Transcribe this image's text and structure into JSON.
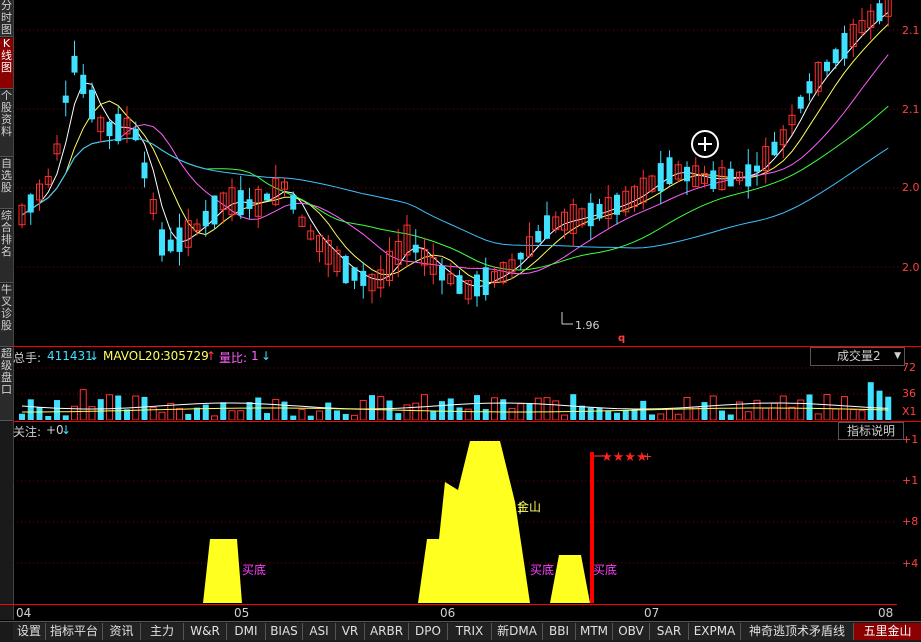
{
  "left_tabs": [
    {
      "label": "分时图",
      "active": false
    },
    {
      "label": "K线图",
      "active": true
    },
    {
      "label": "个股资料",
      "active": false
    },
    {
      "label": "自选股",
      "active": false
    },
    {
      "label": "综合排名",
      "active": false
    },
    {
      "label": "牛叉诊股",
      "active": false
    },
    {
      "label": "超级盘口",
      "active": false
    }
  ],
  "price_axis": [
    "2.1",
    "2.1",
    "2.0",
    "2.0"
  ],
  "price_low_annotation": "1.96",
  "volume_header": {
    "total_label": "总手:",
    "total_value": "411431",
    "mavol_label": "MAVOL20:",
    "mavol_value": "305729",
    "ratio_label": "量比:",
    "ratio_value": "1"
  },
  "volume_selector": "成交量2",
  "volume_axis": [
    "72",
    "36",
    "X1"
  ],
  "indicator_header": {
    "label": "关注:",
    "value": "+0"
  },
  "indicator_button": "指标说明",
  "indicator_axis": [
    "+1",
    "+1",
    "+8",
    "+4"
  ],
  "indicator_annotations": {
    "buy1": "买底",
    "buy2": "买底",
    "buy3": "买底",
    "peak": "金山",
    "stars": "★★★★"
  },
  "dates": [
    "04",
    "05",
    "06",
    "07",
    "08"
  ],
  "bottom_tabs": [
    {
      "label": "设置",
      "active": false
    },
    {
      "label": "指标平台",
      "active": false
    },
    {
      "label": "资讯",
      "active": false
    },
    {
      "label": "主力",
      "active": false
    },
    {
      "label": "W&R",
      "active": false
    },
    {
      "label": "DMI",
      "active": false
    },
    {
      "label": "BIAS",
      "active": false
    },
    {
      "label": "ASI",
      "active": false
    },
    {
      "label": "VR",
      "active": false
    },
    {
      "label": "ARBR",
      "active": false
    },
    {
      "label": "DPO",
      "active": false
    },
    {
      "label": "TRIX",
      "active": false
    },
    {
      "label": "新DMA",
      "active": false
    },
    {
      "label": "BBI",
      "active": false
    },
    {
      "label": "MTM",
      "active": false
    },
    {
      "label": "OBV",
      "active": false
    },
    {
      "label": "SAR",
      "active": false
    },
    {
      "label": "EXPMA",
      "active": false
    },
    {
      "label": "神奇逃顶术矛盾线",
      "active": false
    },
    {
      "label": "五里金山",
      "active": true
    }
  ],
  "colors": {
    "up": "#ff3030",
    "down": "#40e0ff",
    "ma5": "#ffffff",
    "ma10": "#ffff60",
    "ma20": "#ff60ff",
    "ma30": "#40ff40",
    "ma60": "#40c0ff",
    "indicator_fill": "#ffff20"
  }
}
